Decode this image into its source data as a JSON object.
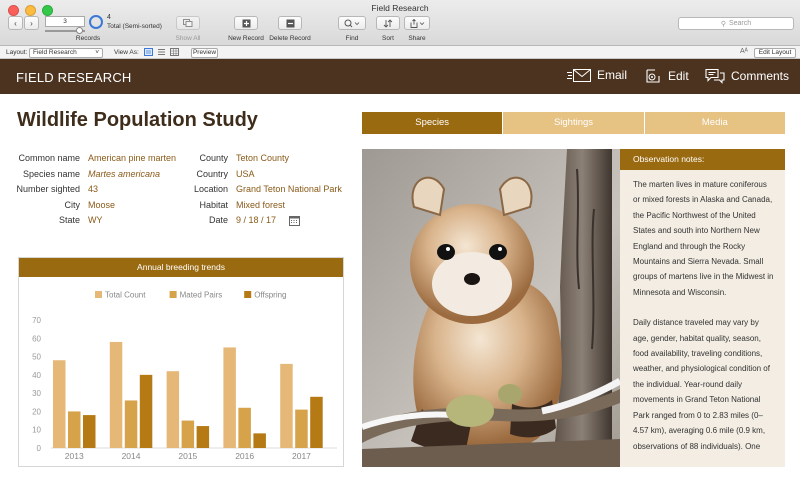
{
  "window": {
    "title": "Field Research"
  },
  "toolbar": {
    "record_number": "3",
    "records_label": "Records",
    "total_count": "4",
    "total_status": "Total (Semi-sorted)",
    "show_all": "Show All",
    "new_record": "New Record",
    "delete_record": "Delete Record",
    "find": "Find",
    "sort": "Sort",
    "share": "Share",
    "search_placeholder": "Search"
  },
  "layoutbar": {
    "layout_label": "Layout:",
    "layout_value": "Field Research",
    "view_as_label": "View As:",
    "preview": "Preview",
    "text_size_glyph": "Aᴬ",
    "edit_layout": "Edit Layout"
  },
  "header": {
    "brand": "FIELD RESEARCH",
    "email": "Email",
    "edit": "Edit",
    "comments": "Comments"
  },
  "page_title": "Wildlife Population Study",
  "fields_left": [
    {
      "label": "Common name",
      "value": "American pine marten",
      "italic": false
    },
    {
      "label": "Species name",
      "value": "Martes americana",
      "italic": true
    },
    {
      "label": "Number sighted",
      "value": "43",
      "italic": false
    },
    {
      "label": "City",
      "value": "Moose",
      "italic": false
    },
    {
      "label": "State",
      "value": "WY",
      "italic": false
    }
  ],
  "fields_right": [
    {
      "label": "County",
      "value": "Teton County"
    },
    {
      "label": "Country",
      "value": "USA"
    },
    {
      "label": "Location",
      "value": "Grand Teton National Park"
    },
    {
      "label": "Habitat",
      "value": "Mixed forest"
    },
    {
      "label": "Date",
      "value": "9 / 18 / 17"
    }
  ],
  "tabs": [
    {
      "label": "Species",
      "active": true
    },
    {
      "label": "Sightings",
      "active": false
    },
    {
      "label": "Media",
      "active": false
    }
  ],
  "notes": {
    "title": "Observation notes:",
    "paragraph1": "The marten lives in mature coniferous or mixed forests in Alaska and Canada, the Pacific Northwest of the United States and south into Northern New England and through the Rocky Mountains and Sierra Nevada. Small groups of martens live in the Midwest in Minnesota and Wisconsin.",
    "paragraph2": "Daily distance traveled may vary by age, gender, habitat quality, season, food availability, traveling conditions, weather, and physiological condition of the individual. Year-round daily movements in Grand Teton National Park ranged from 0 to 2.83 miles (0–4.57 km), averaging 0.6 mile (0.9 km, observations of 88 individuals). One"
  },
  "colors": {
    "brand_brown": "#4b3320",
    "accent_gold": "#9a6a10",
    "tab_inactive": "#e6c283",
    "value_text": "#8a5a18"
  },
  "chart_data": {
    "type": "bar",
    "title": "Annual breeding trends",
    "categories": [
      "2013",
      "2014",
      "2015",
      "2016",
      "2017"
    ],
    "series": [
      {
        "name": "Total Count",
        "color": "#e6b877",
        "values": [
          48,
          58,
          42,
          55,
          46
        ]
      },
      {
        "name": "Mated Pairs",
        "color": "#d6a24a",
        "values": [
          20,
          26,
          15,
          22,
          21
        ]
      },
      {
        "name": "Offspring",
        "color": "#b57a14",
        "values": [
          18,
          40,
          12,
          8,
          28
        ]
      }
    ],
    "ylim": [
      0,
      70
    ],
    "yticks": [
      "0",
      "10",
      "20",
      "30",
      "40",
      "50",
      "60",
      "70"
    ],
    "xlabel": "",
    "ylabel": "",
    "grid": false,
    "legend": "top"
  }
}
